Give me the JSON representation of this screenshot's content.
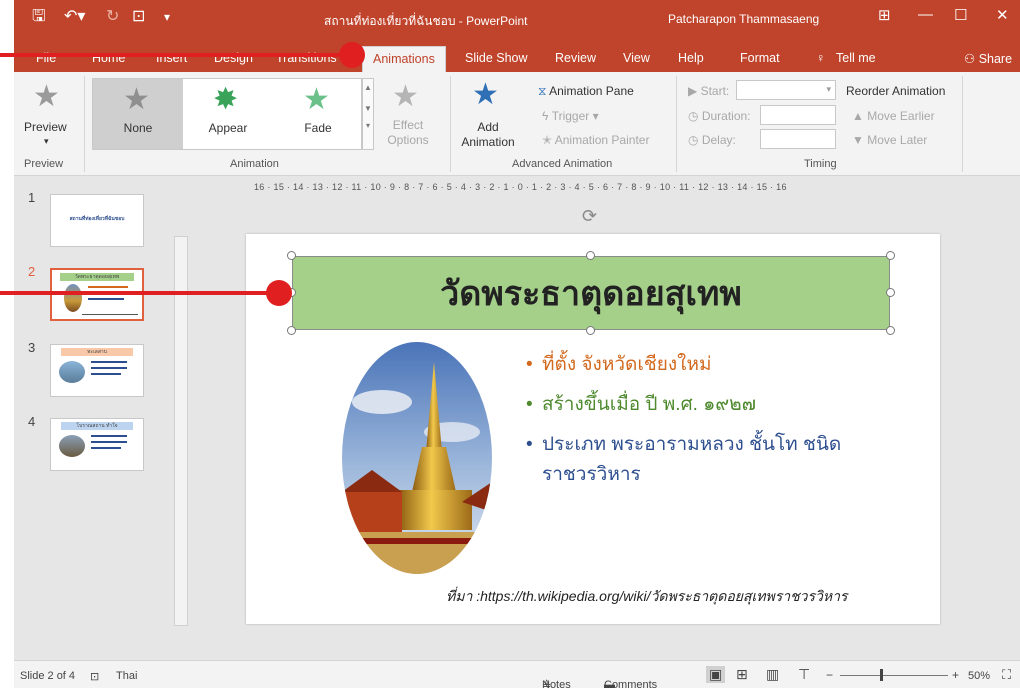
{
  "window": {
    "title": "สถานที่ท่องเที่ยวที่ฉันชอบ - PowerPoint",
    "user": "Patcharapon Thammasaeng"
  },
  "tabs": [
    {
      "label": "File"
    },
    {
      "label": "Home"
    },
    {
      "label": "Insert"
    },
    {
      "label": "Design"
    },
    {
      "label": "Transitions"
    },
    {
      "label": "Animations"
    },
    {
      "label": "Slide Show"
    },
    {
      "label": "Review"
    },
    {
      "label": "View"
    },
    {
      "label": "Help"
    },
    {
      "label": "Format"
    },
    {
      "label": "Tell me"
    }
  ],
  "share_label": "Share",
  "ribbon": {
    "preview": {
      "label": "Preview",
      "group": "Preview"
    },
    "animation_gallery": {
      "items": [
        "None",
        "Appear",
        "Fade"
      ],
      "effect_options": "Effect Options",
      "group": "Animation"
    },
    "advanced": {
      "add_animation": "Add Animation",
      "animation_pane": "Animation Pane",
      "trigger": "Trigger",
      "animation_painter": "Animation Painter",
      "group": "Advanced Animation"
    },
    "timing": {
      "start": "Start:",
      "duration": "Duration:",
      "delay": "Delay:",
      "reorder": "Reorder Animation",
      "move_earlier": "Move Earlier",
      "move_later": "Move Later",
      "group": "Timing"
    }
  },
  "ruler": {
    "horizontal": "16 · 15 · 14 · 13 · 12 · 11 · 10 · 9 · 8 · 7 · 6 · 5 · 4 · 3 · 2 · 1 · 0 · 1 · 2 · 3 · 4 · 5 · 6 · 7 · 8 · 9 · 10 · 11 · 12 · 13 · 14 · 15 · 16"
  },
  "thumbnails": [
    {
      "number": "1",
      "caption": "สถานที่ท่องเที่ยวที่ฉันชอบ"
    },
    {
      "number": "2",
      "caption": "วัดพระธาตุดอยสุเทพ"
    },
    {
      "number": "3",
      "caption": "ทะเลสาบ"
    },
    {
      "number": "4",
      "caption": "โบราณสถาน ทำใจ"
    }
  ],
  "slide": {
    "title": "วัดพระธาตุดอยสุเทพ",
    "bullets": [
      {
        "text": "ที่ตั้ง  จังหวัดเชียงใหม่",
        "color": "#d2691e"
      },
      {
        "text": "สร้างขึ้นเมื่อ ปี พ.ศ. ๑๙๒๗",
        "color": "#4f8a2f"
      },
      {
        "text": "ประเภท พระอารามหลวง ชั้นโท ชนิดราชวรวิหาร",
        "color": "#2e4f8f"
      }
    ],
    "source": "ที่มา :https://th.wikipedia.org/wiki/วัดพระธาตุดอยสุเทพราชวรวิหาร"
  },
  "status": {
    "slide_of": "Slide 2 of 4",
    "language": "Thai",
    "notes": "Notes",
    "comments": "Comments",
    "zoom": "50%"
  },
  "colors": {
    "accent": "#c0432b",
    "title_fill": "#a5d08a",
    "callout": "#e02020"
  }
}
